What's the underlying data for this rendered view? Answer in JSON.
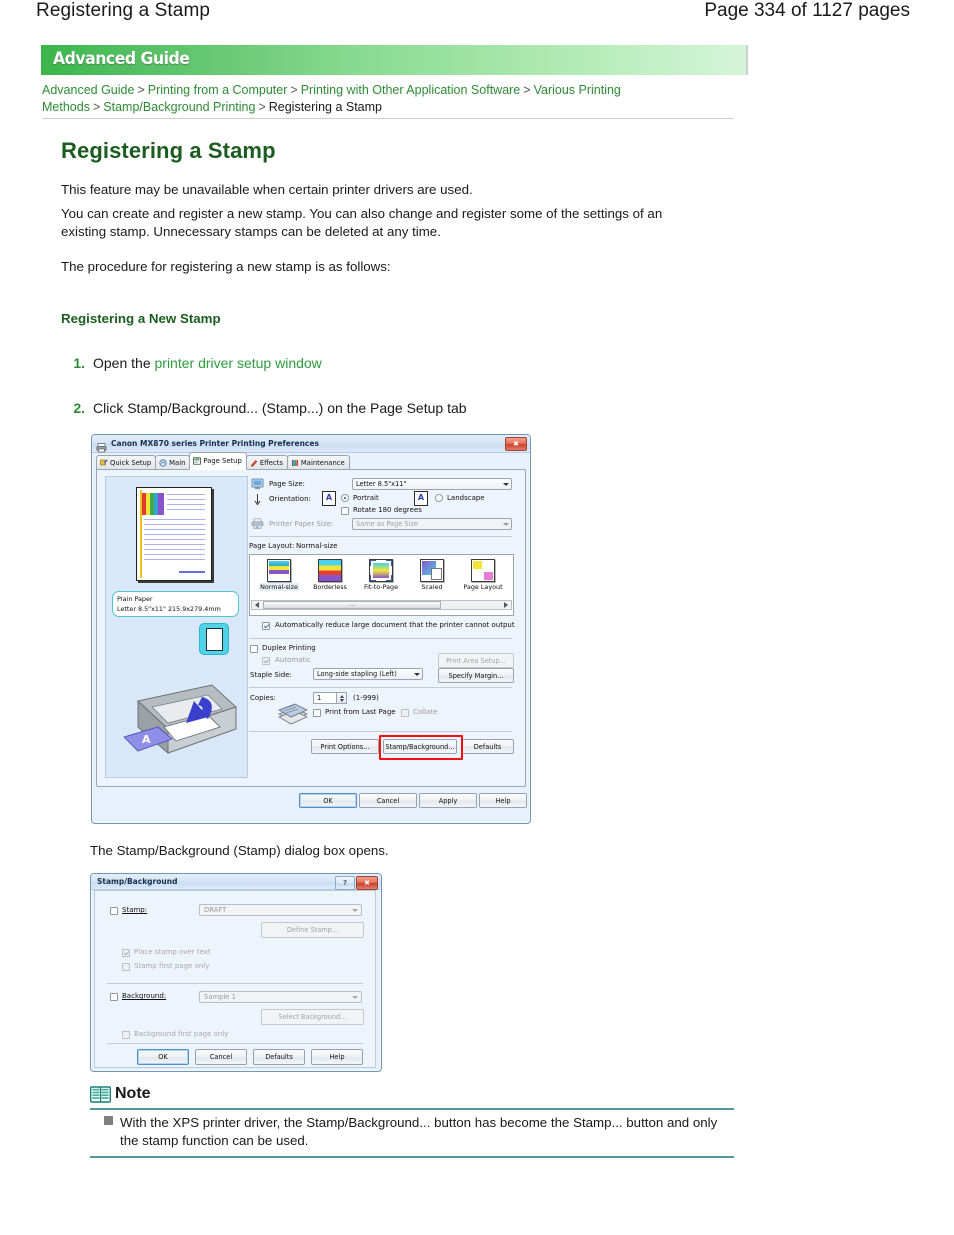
{
  "header": {
    "doc_title": "Registering a Stamp",
    "page_label": "Page 334 of 1127 pages"
  },
  "banner": {
    "title": "Advanced Guide"
  },
  "breadcrumb": {
    "items": [
      "Advanced Guide",
      "Printing from a Computer",
      "Printing with Other Application Software",
      "Various Printing Methods",
      "Stamp/Background Printing",
      "Registering a Stamp"
    ],
    "separator": ">"
  },
  "content": {
    "title": "Registering a Stamp",
    "paragraph1": "This feature may be unavailable when certain printer drivers are used.",
    "paragraph2": "You can create and register a new stamp. You can also change and register some of the settings of an existing stamp. Unnecessary stamps can be deleted at any time.",
    "paragraph3": "The procedure for registering a new stamp is as follows:",
    "subheading": "Registering a New Stamp",
    "steps": [
      {
        "number": "1.",
        "text_before": "Open the ",
        "link": "printer driver setup window",
        "text_after": ""
      },
      {
        "number": "2.",
        "text_before": "Click Stamp/Background... (Stamp...) on the Page Setup tab",
        "link": "",
        "text_after": ""
      }
    ],
    "caption": "The Stamp/Background (Stamp) dialog box opens."
  },
  "printer_dialog": {
    "title": "Canon MX870 series Printer Printing Preferences",
    "close_glyph": "✖",
    "tabs": [
      {
        "label": "Quick Setup",
        "active": false
      },
      {
        "label": "Main",
        "active": false
      },
      {
        "label": "Page Setup",
        "active": true
      },
      {
        "label": "Effects",
        "active": false
      },
      {
        "label": "Maintenance",
        "active": false
      }
    ],
    "preview": {
      "paper_type": "Plain Paper",
      "paper_size": "Letter 8.5\"x11\" 215.9x279.4mm"
    },
    "fields": {
      "page_size_label": "Page Size:",
      "page_size_value": "Letter 8.5\"x11\"",
      "orientation_label": "Orientation:",
      "portrait_label": "Portrait",
      "landscape_label": "Landscape",
      "rotate_label": "Rotate 180 degrees",
      "printer_paper_size_label": "Printer Paper Size:",
      "printer_paper_size_value": "Same as Page Size",
      "page_layout_label": "Page Layout:",
      "page_layout_value": "Normal-size",
      "layout_options": [
        "Normal-size",
        "Borderless",
        "Fit-to-Page",
        "Scaled",
        "Page Layout"
      ],
      "auto_reduce_label": "Automatically reduce large document that the printer cannot output",
      "duplex_label": "Duplex Printing",
      "automatic_label": "Automatic",
      "print_area_setup_label": "Print Area Setup...",
      "staple_side_label": "Staple Side:",
      "staple_side_value": "Long-side stapling (Left)",
      "specify_margin_label": "Specify Margin...",
      "copies_label": "Copies:",
      "copies_value": "1",
      "copies_range": "(1-999)",
      "print_last_page_label": "Print from Last Page",
      "collate_label": "Collate"
    },
    "buttons": {
      "print_options": "Print Options...",
      "stamp_background": "Stamp/Background...",
      "defaults": "Defaults",
      "ok": "OK",
      "cancel": "Cancel",
      "apply": "Apply",
      "help": "Help"
    },
    "highlight_color": "#f20f0f"
  },
  "stamp_dialog": {
    "title": "Stamp/Background",
    "help_glyph": "?",
    "close_glyph": "✖",
    "stamp_label": "Stamp:",
    "stamp_value": "DRAFT",
    "define_stamp_label": "Define Stamp...",
    "place_over_text_label": "Place stamp over text",
    "stamp_first_page_label": "Stamp first page only",
    "background_label": "Background:",
    "background_value": "Sample 1",
    "select_background_label": "Select Background...",
    "background_first_page_label": "Background first page only",
    "buttons": {
      "ok": "OK",
      "cancel": "Cancel",
      "defaults": "Defaults",
      "help": "Help"
    }
  },
  "note": {
    "label": "Note",
    "text": "With the XPS printer driver, the Stamp/Background... button has become the Stamp... button and only the stamp function can be used.",
    "rule_color": "#4f9a9c"
  }
}
